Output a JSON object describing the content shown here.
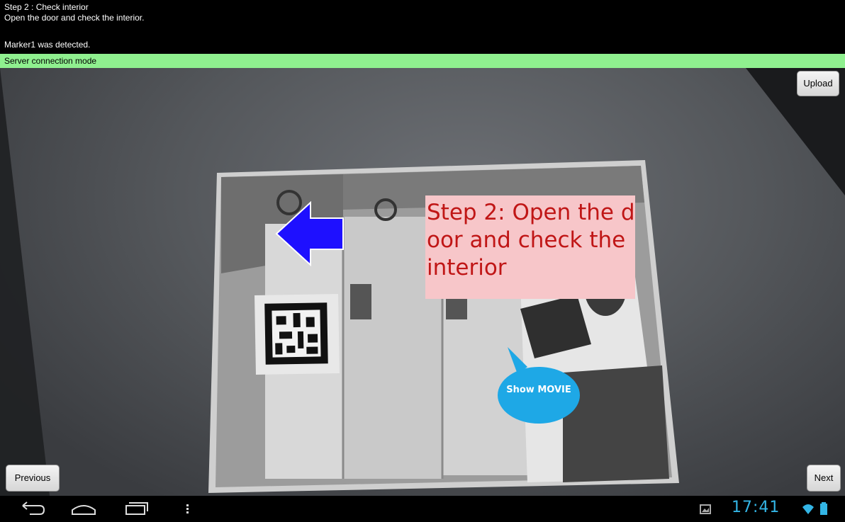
{
  "header": {
    "step_title": "Step 2 : Check interior",
    "step_instruction": "Open the door and check the interior.",
    "detection_status": "Marker1 was detected."
  },
  "status_bar": {
    "mode_text": "Server connection mode",
    "color": "#8ff08f"
  },
  "buttons": {
    "upload_label": "Upload",
    "previous_label": "Previous",
    "next_label": "Next"
  },
  "overlay": {
    "step_callout_text": "Step 2: Open the door and check the interior",
    "callout_bg": "#f7c6c9",
    "callout_text_color": "#c01616",
    "arrow_color": "#1e10ff",
    "show_movie_label": "Show MOVIE",
    "show_movie_color": "#1ea8e6"
  },
  "system_bar": {
    "time": "17:41",
    "icons": [
      "back-icon",
      "home-icon",
      "recent-apps-icon",
      "menu-icon",
      "gallery-notification-icon",
      "wifi-icon",
      "battery-icon"
    ]
  }
}
